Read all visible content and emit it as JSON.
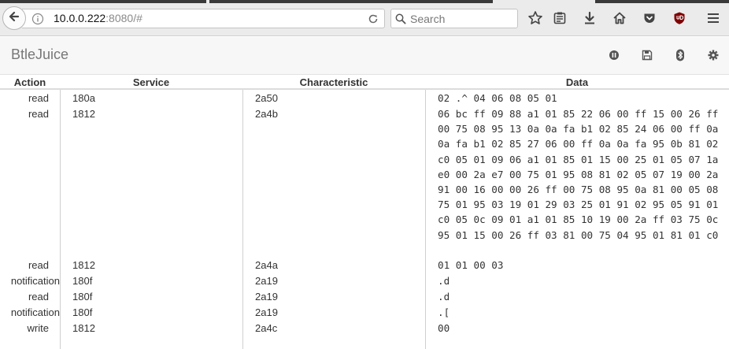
{
  "browser": {
    "url_host": "10.0.0.222",
    "url_rest": ":8080/#",
    "search_placeholder": "Search"
  },
  "app": {
    "brand": "BtleJuice"
  },
  "table": {
    "headers": {
      "action": "Action",
      "service": "Service",
      "characteristic": "Characteristic",
      "data": "Data"
    },
    "rows": [
      {
        "action": "read",
        "service": "180a",
        "characteristic": "2a50",
        "data": "02 .^ 04 06 08 05 01"
      },
      {
        "action": "read",
        "service": "1812",
        "characteristic": "2a4b",
        "data": "06 bc ff 09 88 a1 01 85 22 06 00 ff 15 00 26 ff 00 75 08 95 13 0a 0a fa b1 02 85 24 06 00 ff 0a 0a fa b1 02 85 27 06 00 ff 0a 0a fa 95 0b 81 02 c0 05 01 09 06 a1 01 85 01 15 00 25 01 05 07 1a e0 00 2a e7 00 75 01 95 08 81 02 05 07 19 00 2a 91 00 16 00 00 26 ff 00 75 08 95 0a 81 00 05 08 75 01 95 03 19 01 29 03 25 01 91 02 95 05 91 01 c0 05 0c 09 01 a1 01 85 10 19 00 2a ff 03 75 0c 95 01 15 00 26 ff 03 81 00 75 04 95 01 81 01 c0"
      },
      {
        "action": "read",
        "service": "1812",
        "characteristic": "2a4a",
        "data": "01 01 00 03"
      },
      {
        "action": "notification",
        "service": "180f",
        "characteristic": "2a19",
        "data": ".d"
      },
      {
        "action": "read",
        "service": "180f",
        "characteristic": "2a19",
        "data": ".d"
      },
      {
        "action": "notification",
        "service": "180f",
        "characteristic": "2a19",
        "data": ".["
      },
      {
        "action": "write",
        "service": "1812",
        "characteristic": "2a4c",
        "data": "00"
      }
    ]
  }
}
